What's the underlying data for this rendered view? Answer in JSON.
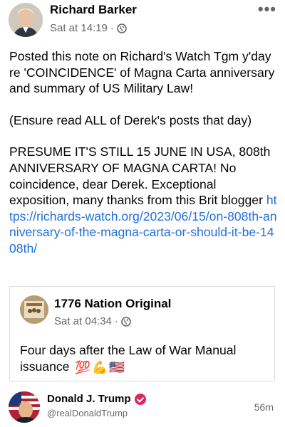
{
  "post": {
    "author": "Richard Barker",
    "time": "Sat at 14:19",
    "privacy_dot": "·",
    "more_label": "•••",
    "paragraph1": "Posted this note on Richard's Watch Tgm y'day re 'COINCIDENCE' of Magna Carta anniversary and summary of US Military Law!",
    "paragraph2": "(Ensure read ALL of Derek's posts that day)",
    "paragraph3": "PRESUME IT'S STILL 15 JUNE IN USA, 808th ANNIVERSARY OF MAGNA CARTA! No coincidence, dear Derek. Exceptional exposition, many thanks from this Brit blogger",
    "link": "https://richards-watch.org/2023/06/15/on-808th-anniversary-of-the-magna-carta-or-should-it-be-1408th/"
  },
  "shared": {
    "author": "1776 Nation Original",
    "time": "Sat at 04:34",
    "privacy_dot": "·",
    "text": "Four days after the Law of War Manual issuance",
    "emojis": [
      "💯",
      "💪",
      "🇺🇸"
    ]
  },
  "next_post": {
    "name": "Donald J. Trump",
    "handle": "@realDonaldTrump",
    "time_ago": "56m"
  },
  "icons": {
    "privacy": "globe-icon",
    "more": "more-horizontal-icon",
    "verified": "verified-badge-icon"
  },
  "colors": {
    "link": "#216fdb",
    "meta": "#65676b",
    "verified": "#e0245e"
  }
}
